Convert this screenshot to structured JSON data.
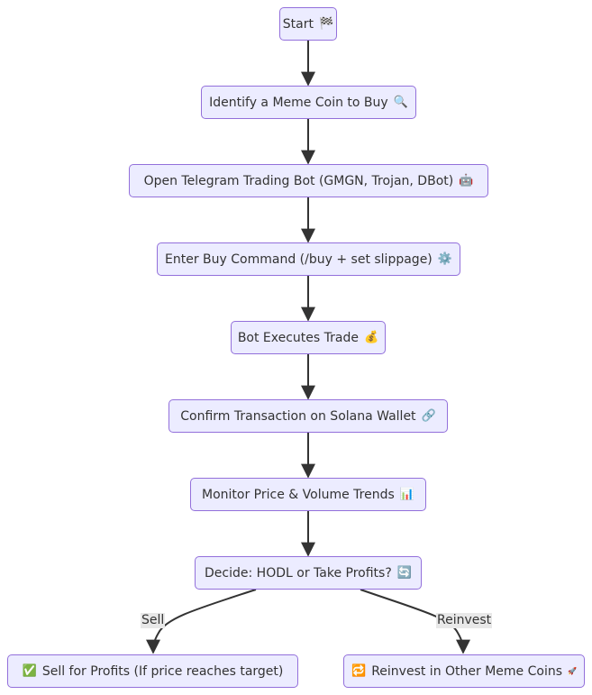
{
  "diagram": {
    "type": "flowchart",
    "direction": "top-down",
    "colors": {
      "node_fill": "#ECECFF",
      "node_border": "#9370DB",
      "edge": "#333333",
      "text": "#333333",
      "label_bg": "#e8e8e8"
    },
    "nodes": [
      {
        "id": "start",
        "label": "Start",
        "icon": "🏁",
        "icon_name": "checkered-flag-icon"
      },
      {
        "id": "identify",
        "label": "Identify a Meme Coin to Buy",
        "icon": "🔍",
        "icon_name": "magnifier-icon"
      },
      {
        "id": "open_bot",
        "label": "Open Telegram Trading Bot (GMGN, Trojan, DBot)",
        "icon": "🤖",
        "icon_name": "robot-icon"
      },
      {
        "id": "buy_cmd",
        "label": "Enter Buy Command (/buy + set slippage)",
        "icon": "⚙️",
        "icon_name": "gear-icon"
      },
      {
        "id": "execute",
        "label": "Bot Executes Trade",
        "icon": "💰",
        "icon_name": "money-bag-icon"
      },
      {
        "id": "confirm",
        "label": "Confirm Transaction on Solana Wallet",
        "icon": "🔗",
        "icon_name": "link-icon"
      },
      {
        "id": "monitor",
        "label": "Monitor Price & Volume Trends",
        "icon": "📊",
        "icon_name": "bar-chart-icon"
      },
      {
        "id": "decide",
        "label": "Decide: HODL or Take Profits?",
        "icon": "🔄",
        "icon_name": "refresh-icon"
      },
      {
        "id": "sell",
        "label": "Sell for Profits (If price reaches target)",
        "prefix_icon": "✅",
        "prefix_icon_name": "check-mark-icon"
      },
      {
        "id": "reinvest",
        "label": "Reinvest in Other Meme Coins",
        "prefix_icon": "🔁",
        "prefix_icon_name": "repeat-icon",
        "icon": "🚀",
        "icon_name": "rocket-icon"
      }
    ],
    "edges": [
      {
        "from": "start",
        "to": "identify",
        "label": ""
      },
      {
        "from": "identify",
        "to": "open_bot",
        "label": ""
      },
      {
        "from": "open_bot",
        "to": "buy_cmd",
        "label": ""
      },
      {
        "from": "buy_cmd",
        "to": "execute",
        "label": ""
      },
      {
        "from": "execute",
        "to": "confirm",
        "label": ""
      },
      {
        "from": "confirm",
        "to": "monitor",
        "label": ""
      },
      {
        "from": "monitor",
        "to": "decide",
        "label": ""
      },
      {
        "from": "decide",
        "to": "sell",
        "label": "Sell"
      },
      {
        "from": "decide",
        "to": "reinvest",
        "label": "Reinvest"
      }
    ]
  }
}
